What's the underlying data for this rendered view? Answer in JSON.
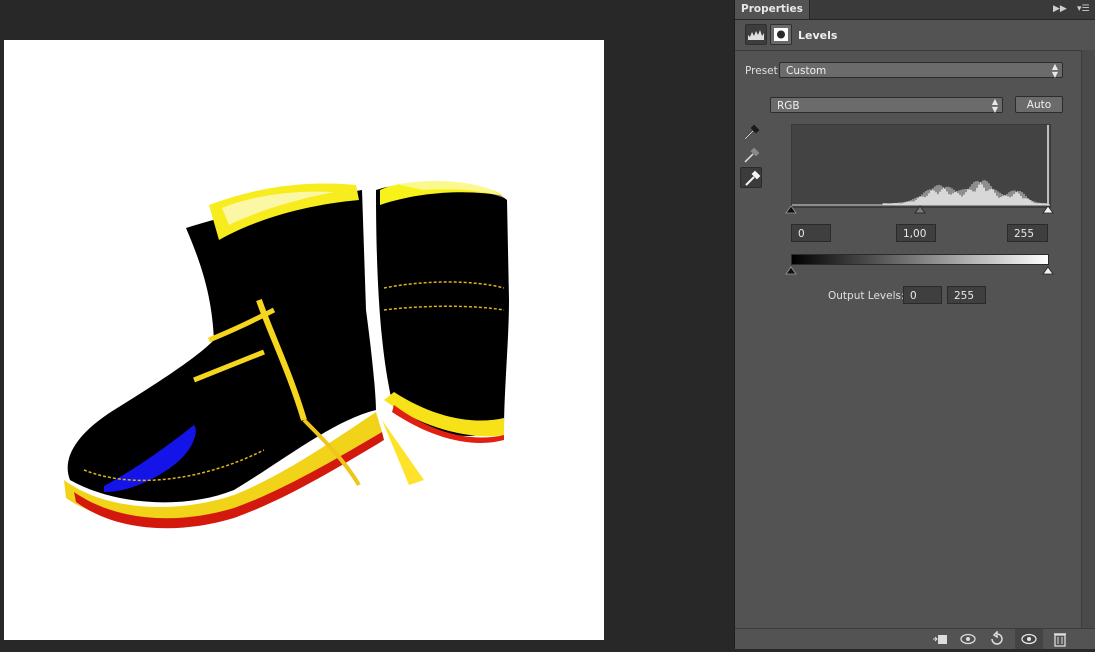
{
  "panel": {
    "tab_label": "Properties",
    "adjustment_title": "Levels",
    "preset_label": "Preset:",
    "preset_value": "Custom",
    "channel_value": "RGB",
    "auto_label": "Auto",
    "input_shadow": "0",
    "input_midtone": "1,00",
    "input_highlight": "255",
    "output_label": "Output Levels:",
    "output_low": "0",
    "output_high": "255"
  },
  "icons": {
    "header": [
      "expand-panel-icon",
      "panel-menu-icon"
    ],
    "toolbar": [
      "levels-adjustment-icon",
      "layer-mask-icon"
    ],
    "eyedroppers": [
      "black-point-eyedropper-icon",
      "gray-point-eyedropper-icon",
      "white-point-eyedropper-icon"
    ],
    "footer": [
      "clip-to-layer-icon",
      "view-previous-state-icon",
      "reset-icon",
      "visibility-eye-icon",
      "trash-icon"
    ]
  },
  "colors": {
    "app_bg": "#282828",
    "panel_bg": "#535353",
    "histogram_bg": "#434343"
  }
}
